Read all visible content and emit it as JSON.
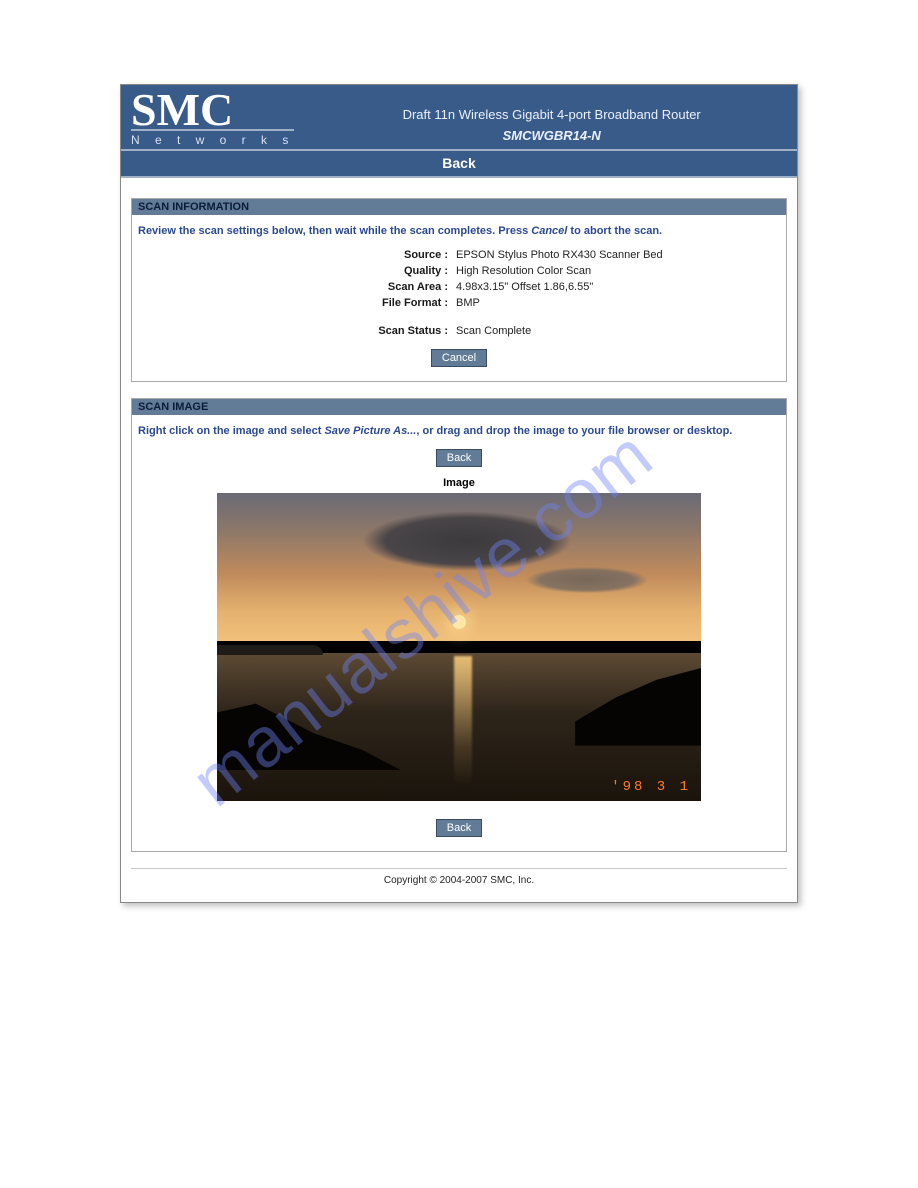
{
  "brand": {
    "name": "SMC",
    "sub": "N e t w o r k s"
  },
  "header": {
    "product_desc": "Draft 11n Wireless Gigabit 4-port Broadband Router",
    "model": "SMCWGBR14-N",
    "page_title": "Back"
  },
  "scan_info": {
    "panel_title": "SCAN INFORMATION",
    "instructions_pre": "Review the scan settings below, then wait while the scan completes. Press ",
    "instructions_em": "Cancel",
    "instructions_post": " to abort the scan.",
    "rows": {
      "source_k": "Source :",
      "source_v": "EPSON Stylus Photo RX430 Scanner Bed",
      "quality_k": "Quality :",
      "quality_v": "High Resolution Color Scan",
      "area_k": "Scan Area :",
      "area_v": "4.98x3.15\" Offset 1.86,6.55\"",
      "format_k": "File Format :",
      "format_v": "BMP",
      "status_k": "Scan Status :",
      "status_v": "Scan Complete"
    },
    "cancel_btn": "Cancel"
  },
  "scan_image": {
    "panel_title": "SCAN IMAGE",
    "instructions_pre": "Right click on the image and select ",
    "instructions_em": "Save Picture As...",
    "instructions_post": ", or drag and drop the image to your file browser or desktop.",
    "back_btn_top": "Back",
    "image_caption": "Image",
    "photo_date": "'98  3  1",
    "back_btn_bottom": "Back"
  },
  "footer": {
    "copyright": "Copyright © 2004-2007 SMC, Inc."
  },
  "watermark": "manualshive.com"
}
